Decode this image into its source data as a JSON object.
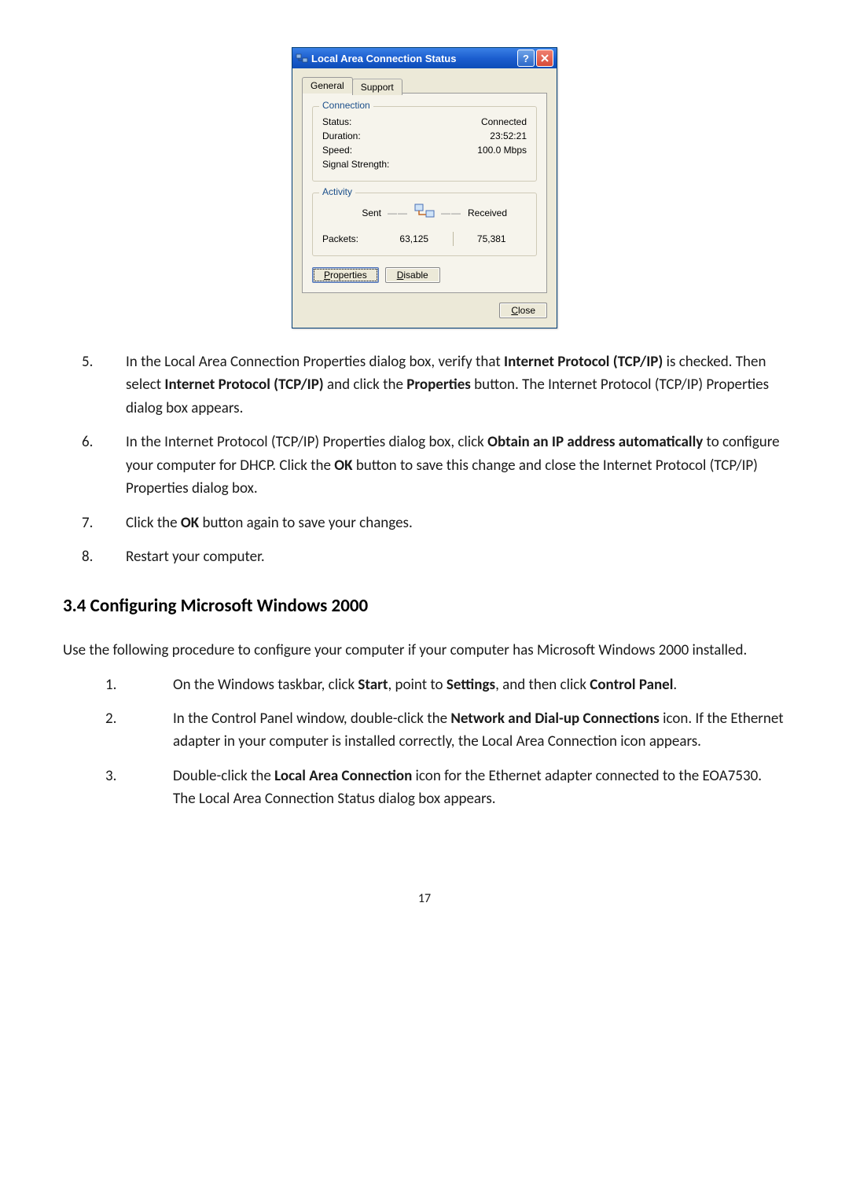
{
  "dialog": {
    "title": "Local Area Connection Status",
    "tabs": {
      "general": "General",
      "support": "Support"
    },
    "connection": {
      "legend": "Connection",
      "status_label": "Status:",
      "status_value": "Connected",
      "duration_label": "Duration:",
      "duration_value": "23:52:21",
      "speed_label": "Speed:",
      "speed_value": "100.0 Mbps",
      "signal_label": "Signal Strength:"
    },
    "activity": {
      "legend": "Activity",
      "sent_label": "Sent",
      "received_label": "Received",
      "packets_label": "Packets:",
      "sent_value": "63,125",
      "recv_value": "75,381"
    },
    "buttons": {
      "properties": "Properties",
      "disable": "Disable",
      "close": "Close"
    }
  },
  "steps_a": {
    "5": {
      "num": "5.",
      "pre": "In the Local Area Connection Properties dialog box, verify that ",
      "b1": "Internet Protocol (TCP/IP)",
      "mid1": " is checked. Then select ",
      "b2": "Internet Protocol (TCP/IP)",
      "mid2": " and click the ",
      "b3": "Properties",
      "post": " button. The Internet Protocol (TCP/IP) Properties dialog box appears."
    },
    "6": {
      "num": "6.",
      "pre": "In the Internet Protocol (TCP/IP) Properties dialog box, click ",
      "b1": "Obtain an IP address automatically",
      "mid1": " to configure your computer for DHCP. Click the ",
      "b2": "OK",
      "post": " button to save this change and close the Internet Protocol (TCP/IP) Properties dialog box."
    },
    "7": {
      "num": "7.",
      "pre": "Click the ",
      "b1": "OK",
      "post": " button again to save your changes."
    },
    "8": {
      "num": "8.",
      "text": "Restart your computer."
    }
  },
  "heading": "3.4 Configuring Microsoft Windows 2000",
  "intro": "Use the following procedure to configure your computer if your computer has Microsoft Windows 2000 installed.",
  "steps_b": {
    "1": {
      "num": "1.",
      "pre": "On the Windows taskbar, click ",
      "b1": "Start",
      "mid1": ", point to ",
      "b2": "Settings",
      "mid2": ", and then click ",
      "b3": "Control Panel",
      "post": "."
    },
    "2": {
      "num": "2.",
      "pre": "In the Control Panel window, double-click the ",
      "b1": "Network and Dial-up Connections",
      "post": " icon. If the Ethernet adapter in your computer is installed correctly, the Local Area Connection icon appears."
    },
    "3": {
      "num": "3.",
      "pre": "Double-click the ",
      "b1": "Local Area Connection",
      "post": " icon for the Ethernet adapter connected to the EOA7530. The Local Area Connection Status dialog box appears."
    }
  },
  "page_number": "17"
}
